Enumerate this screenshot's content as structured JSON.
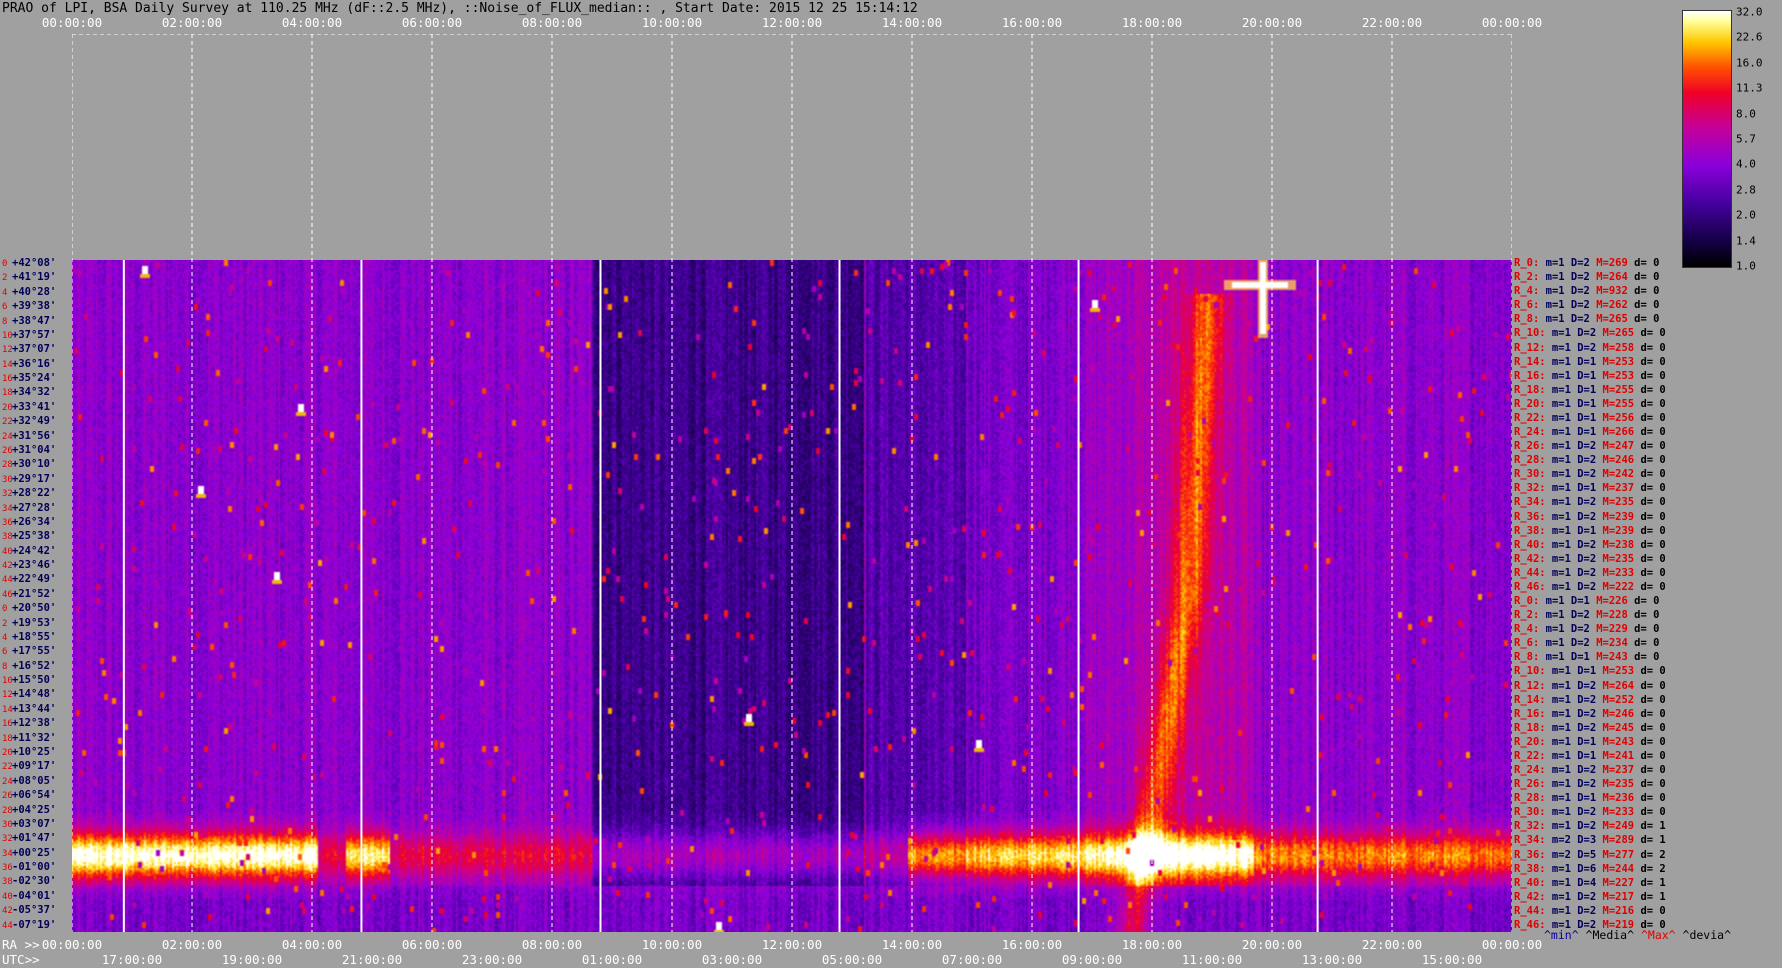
{
  "title": "PRAO of LPI, BSA Daily Survey at 110.25 MHz (dF::2.5 MHz), ::Noise_of_FLUX_median:: , Start Date: 2015 12 25 15:14:12",
  "chart_data": {
    "type": "heatmap",
    "title": "PRAO of LPI, BSA Daily Survey at 110.25 MHz (dF::2.5 MHz), ::Noise_of_FLUX_median:: , Start Date: 2015 12 25 15:14:12",
    "top_ticks": [
      "00:00:00",
      "02:00:00",
      "04:00:00",
      "06:00:00",
      "08:00:00",
      "10:00:00",
      "12:00:00",
      "14:00:00",
      "16:00:00",
      "18:00:00",
      "20:00:00",
      "22:00:00",
      "00:00:00"
    ],
    "ra_label": "RA >>",
    "ra_ticks": [
      "00:00:00",
      "02:00:00",
      "04:00:00",
      "06:00:00",
      "08:00:00",
      "10:00:00",
      "12:00:00",
      "14:00:00",
      "16:00:00",
      "18:00:00",
      "20:00:00",
      "22:00:00",
      "00:00:00"
    ],
    "utc_label": "UTC>>",
    "utc_ticks": [
      "17:00:00",
      "19:00:00",
      "21:00:00",
      "23:00:00",
      "01:00:00",
      "03:00:00",
      "05:00:00",
      "07:00:00",
      "09:00:00",
      "11:00:00",
      "13:00:00",
      "15:00:00"
    ],
    "colorbar_ticks": [
      "32.0",
      "22.6",
      "16.0",
      "11.3",
      "8.0",
      "5.7",
      "4.0",
      "2.8",
      "2.0",
      "1.4",
      "1.0"
    ],
    "colorbar_range": [
      1.0,
      32.0
    ],
    "declinations": [
      "+42°08'",
      "+41°19'",
      "+40°28'",
      "+39°38'",
      "+38°47'",
      "+37°57'",
      "+37°07'",
      "+36°16'",
      "+35°24'",
      "+34°32'",
      "+33°41'",
      "+32°49'",
      "+31°56'",
      "+31°04'",
      "+30°10'",
      "+29°17'",
      "+28°22'",
      "+27°28'",
      "+26°34'",
      "+25°38'",
      "+24°42'",
      "+23°46'",
      "+22°49'",
      "+21°52'",
      "+20°50'",
      "+19°53'",
      "+18°55'",
      "+17°55'",
      "+16°52'",
      "+15°50'",
      "+14°48'",
      "+13°44'",
      "+12°38'",
      "+11°32'",
      "+10°25'",
      "+09°17'",
      "+08°05'",
      "+06°54'",
      "+04°25'",
      "+03°07'",
      "+01°47'",
      "+00°25'",
      "-01°00'",
      "-02°30'",
      "-04°01'",
      "-05°37'",
      "-07°19'"
    ],
    "dec_indices": [
      "0",
      "2",
      "4",
      "6",
      "8",
      "10",
      "12",
      "14",
      "16",
      "18",
      "20",
      "22",
      "24",
      "26",
      "28",
      "30",
      "32",
      "34",
      "36",
      "38",
      "40",
      "42",
      "44",
      "46",
      "0",
      "2",
      "4",
      "6",
      "8",
      "10",
      "12",
      "14",
      "16",
      "18",
      "20",
      "22",
      "24",
      "26",
      "28",
      "30",
      "32",
      "34",
      "36",
      "38",
      "40",
      "42",
      "44"
    ],
    "rows": [
      {
        "name": "R_0:",
        "m": "m=1",
        "D": "D=2",
        "M": "M=269",
        "d": "d= 0"
      },
      {
        "name": "R_2:",
        "m": "m=1",
        "D": "D=2",
        "M": "M=264",
        "d": "d= 0"
      },
      {
        "name": "R_4:",
        "m": "m=1",
        "D": "D=2",
        "M": "M=932",
        "d": "d= 0"
      },
      {
        "name": "R_6:",
        "m": "m=1",
        "D": "D=2",
        "M": "M=262",
        "d": "d= 0"
      },
      {
        "name": "R_8:",
        "m": "m=1",
        "D": "D=2",
        "M": "M=265",
        "d": "d= 0"
      },
      {
        "name": "R_10:",
        "m": "m=1",
        "D": "D=2",
        "M": "M=265",
        "d": "d= 0"
      },
      {
        "name": "R_12:",
        "m": "m=1",
        "D": "D=2",
        "M": "M=258",
        "d": "d= 0"
      },
      {
        "name": "R_14:",
        "m": "m=1",
        "D": "D=1",
        "M": "M=253",
        "d": "d= 0"
      },
      {
        "name": "R_16:",
        "m": "m=1",
        "D": "D=1",
        "M": "M=253",
        "d": "d= 0"
      },
      {
        "name": "R_18:",
        "m": "m=1",
        "D": "D=1",
        "M": "M=255",
        "d": "d= 0"
      },
      {
        "name": "R_20:",
        "m": "m=1",
        "D": "D=1",
        "M": "M=255",
        "d": "d= 0"
      },
      {
        "name": "R_22:",
        "m": "m=1",
        "D": "D=1",
        "M": "M=256",
        "d": "d= 0"
      },
      {
        "name": "R_24:",
        "m": "m=1",
        "D": "D=1",
        "M": "M=266",
        "d": "d= 0"
      },
      {
        "name": "R_26:",
        "m": "m=1",
        "D": "D=2",
        "M": "M=247",
        "d": "d= 0"
      },
      {
        "name": "R_28:",
        "m": "m=1",
        "D": "D=2",
        "M": "M=246",
        "d": "d= 0"
      },
      {
        "name": "R_30:",
        "m": "m=1",
        "D": "D=2",
        "M": "M=242",
        "d": "d= 0"
      },
      {
        "name": "R_32:",
        "m": "m=1",
        "D": "D=1",
        "M": "M=237",
        "d": "d= 0"
      },
      {
        "name": "R_34:",
        "m": "m=1",
        "D": "D=2",
        "M": "M=235",
        "d": "d= 0"
      },
      {
        "name": "R_36:",
        "m": "m=1",
        "D": "D=2",
        "M": "M=239",
        "d": "d= 0"
      },
      {
        "name": "R_38:",
        "m": "m=1",
        "D": "D=1",
        "M": "M=239",
        "d": "d= 0"
      },
      {
        "name": "R_40:",
        "m": "m=1",
        "D": "D=2",
        "M": "M=238",
        "d": "d= 0"
      },
      {
        "name": "R_42:",
        "m": "m=1",
        "D": "D=2",
        "M": "M=235",
        "d": "d= 0"
      },
      {
        "name": "R_44:",
        "m": "m=1",
        "D": "D=2",
        "M": "M=233",
        "d": "d= 0"
      },
      {
        "name": "R_46:",
        "m": "m=1",
        "D": "D=2",
        "M": "M=222",
        "d": "d= 0"
      },
      {
        "name": "R_0:",
        "m": "m=1",
        "D": "D=1",
        "M": "M=226",
        "d": "d= 0"
      },
      {
        "name": "R_2:",
        "m": "m=1",
        "D": "D=2",
        "M": "M=228",
        "d": "d= 0"
      },
      {
        "name": "R_4:",
        "m": "m=1",
        "D": "D=2",
        "M": "M=229",
        "d": "d= 0"
      },
      {
        "name": "R_6:",
        "m": "m=1",
        "D": "D=2",
        "M": "M=234",
        "d": "d= 0"
      },
      {
        "name": "R_8:",
        "m": "m=1",
        "D": "D=1",
        "M": "M=243",
        "d": "d= 0"
      },
      {
        "name": "R_10:",
        "m": "m=1",
        "D": "D=1",
        "M": "M=253",
        "d": "d= 0"
      },
      {
        "name": "R_12:",
        "m": "m=1",
        "D": "D=2",
        "M": "M=264",
        "d": "d= 0"
      },
      {
        "name": "R_14:",
        "m": "m=1",
        "D": "D=2",
        "M": "M=252",
        "d": "d= 0"
      },
      {
        "name": "R_16:",
        "m": "m=1",
        "D": "D=2",
        "M": "M=246",
        "d": "d= 0"
      },
      {
        "name": "R_18:",
        "m": "m=1",
        "D": "D=2",
        "M": "M=245",
        "d": "d= 0"
      },
      {
        "name": "R_20:",
        "m": "m=1",
        "D": "D=1",
        "M": "M=243",
        "d": "d= 0"
      },
      {
        "name": "R_22:",
        "m": "m=1",
        "D": "D=1",
        "M": "M=241",
        "d": "d= 0"
      },
      {
        "name": "R_24:",
        "m": "m=1",
        "D": "D=2",
        "M": "M=237",
        "d": "d= 0"
      },
      {
        "name": "R_26:",
        "m": "m=1",
        "D": "D=2",
        "M": "M=235",
        "d": "d= 0"
      },
      {
        "name": "R_28:",
        "m": "m=1",
        "D": "D=1",
        "M": "M=236",
        "d": "d= 0"
      },
      {
        "name": "R_30:",
        "m": "m=1",
        "D": "D=2",
        "M": "M=233",
        "d": "d= 0"
      },
      {
        "name": "R_32:",
        "m": "m=1",
        "D": "D=2",
        "M": "M=249",
        "d": "d= 1"
      },
      {
        "name": "R_34:",
        "m": "m=2",
        "D": "D=3",
        "M": "M=289",
        "d": "d= 1"
      },
      {
        "name": "R_36:",
        "m": "m=2",
        "D": "D=5",
        "M": "M=277",
        "d": "d= 2"
      },
      {
        "name": "R_38:",
        "m": "m=1",
        "D": "D=6",
        "M": "M=244",
        "d": "d= 2"
      },
      {
        "name": "R_40:",
        "m": "m=1",
        "D": "D=4",
        "M": "M=227",
        "d": "d= 1"
      },
      {
        "name": "R_42:",
        "m": "m=1",
        "D": "D=2",
        "M": "M=217",
        "d": "d= 1"
      },
      {
        "name": "R_44:",
        "m": "m=1",
        "D": "D=2",
        "M": "M=216",
        "d": "d= 0"
      },
      {
        "name": "R_46:",
        "m": "m=1",
        "D": "D=2",
        "M": "M=219",
        "d": "d= 0"
      }
    ],
    "legend": {
      "min": "^min^",
      "median": "^Media^",
      "max": "^Max^",
      "dev": "^devia^"
    }
  }
}
